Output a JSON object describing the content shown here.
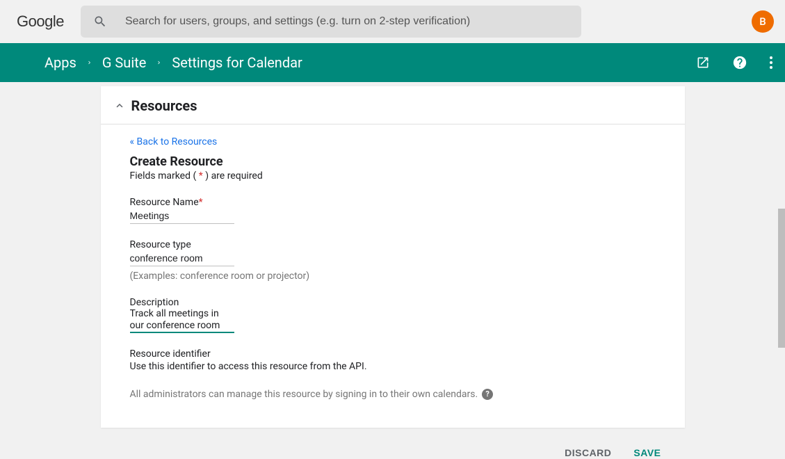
{
  "topbar": {
    "logo": "Google",
    "search_placeholder": "Search for users, groups, and settings (e.g. turn on 2-step verification)",
    "avatar_initial": "B"
  },
  "breadcrumbs": {
    "items": [
      "Apps",
      "G Suite",
      "Settings for Calendar"
    ]
  },
  "card": {
    "section_title": "Resources",
    "back_link": "« Back to Resources",
    "form_title": "Create Resource",
    "required_prefix": "Fields marked ( ",
    "required_star": "*",
    "required_suffix": " ) are required",
    "fields": {
      "resource_name": {
        "label": "Resource Name",
        "value": "Meetings"
      },
      "resource_type": {
        "label": "Resource type",
        "value": "conference room",
        "hint": "(Examples: conference room or projector)"
      },
      "description": {
        "label": "Description",
        "value": "Track all meetings in our conference room"
      },
      "identifier": {
        "label": "Resource identifier",
        "text": "Use this identifier to access this resource from the API."
      }
    },
    "admin_note": "All administrators can manage this resource by signing in to their own calendars."
  },
  "actions": {
    "discard": "DISCARD",
    "save": "SAVE"
  }
}
